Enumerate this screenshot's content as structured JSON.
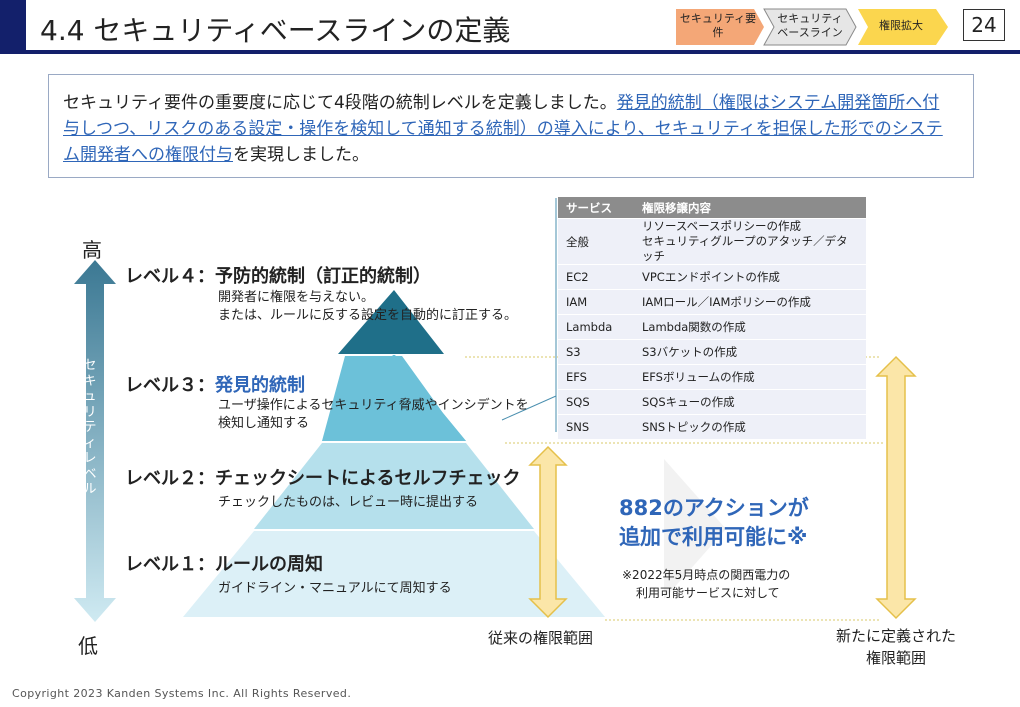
{
  "header": {
    "title": "4.4 セキュリティベースラインの定義",
    "steps": [
      "セキュリティ要件",
      "セキュリティ\nベースライン",
      "権限拡大"
    ],
    "page_number": "24",
    "colors": {
      "navy": "#13206b",
      "step1": "#f4a777",
      "step2": "#e6e6e6",
      "step3": "#fbd64e"
    }
  },
  "summary": {
    "lead": "セキュリティ要件の重要度に応じて4段階の統制レベルを定義しました。",
    "highlight": "発見的統制（権限はシステム開発箇所へ付与しつつ、リスクのある設定・操作を検知して通知する統制）の導入により、セキュリティを担保した形でのシステム開発者への権限付与",
    "tail": "を実現しました。"
  },
  "axis": {
    "high": "高",
    "low": "低",
    "label": "セキュリティレベル"
  },
  "levels": [
    {
      "title": "レベル４：予防的統制（訂正的統制）",
      "desc1": "開発者に権限を与えない。",
      "desc2": "または、ルールに反する設定を自動的に訂正する。"
    },
    {
      "title_prefix": "レベル３：",
      "title_blue": "発見的統制",
      "desc1": "ユーザ操作によるセキュリティ脅威やインシデントを",
      "desc2": "検知し通知する"
    },
    {
      "title": "レベル２：チェックシートによるセルフチェック",
      "desc1": "チェックしたものは、レビュー時に提出する"
    },
    {
      "title": "レベル１：ルールの周知",
      "desc1": "ガイドライン・マニュアルにて周知する"
    }
  ],
  "table": {
    "headers": [
      "サービス",
      "権限移譲内容"
    ],
    "rows": [
      [
        "全般",
        "リソースベースポリシーの作成\nセキュリティグループのアタッチ／デタッチ"
      ],
      [
        "EC2",
        "VPCエンドポイントの作成"
      ],
      [
        "IAM",
        "IAMロール／IAMポリシーの作成"
      ],
      [
        "Lambda",
        "Lambda関数の作成"
      ],
      [
        "S3",
        "S3バケットの作成"
      ],
      [
        "EFS",
        "EFSボリュームの作成"
      ],
      [
        "SQS",
        "SQSキューの作成"
      ],
      [
        "SNS",
        "SNSトピックの作成"
      ]
    ]
  },
  "message": {
    "line1": "882のアクションが",
    "line2": "追加で利用可能に※",
    "note1": "※2022年5月時点の関西電力の",
    "note2": "利用可能サービスに対して"
  },
  "captions": {
    "old_range": "従来の権限範囲",
    "new_range_1": "新たに定義された",
    "new_range_2": "権限範囲"
  },
  "footer": "Copyright 2023 Kanden Systems Inc. All Rights Reserved."
}
